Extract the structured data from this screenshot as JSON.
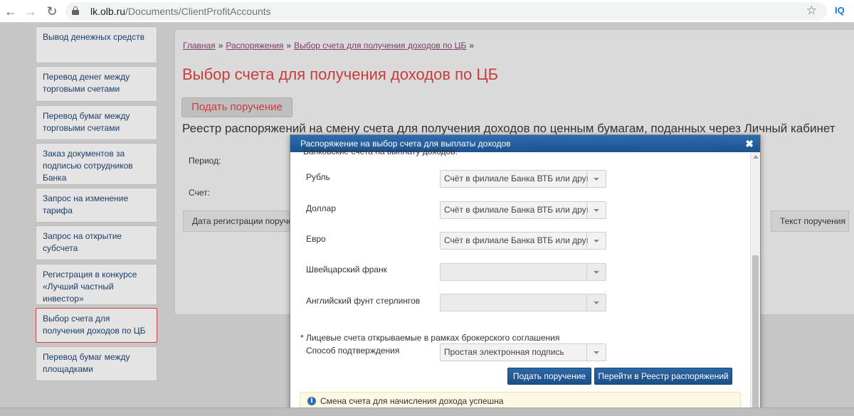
{
  "browser": {
    "url_host": "lk.olb.ru",
    "url_path": "/Documents/ClientProfitAccounts",
    "extension_label": "IQ"
  },
  "sidebar": {
    "items": [
      {
        "label": "Вывод денежных средств"
      },
      {
        "label": "Перевод денег между торговыми счетами"
      },
      {
        "label": "Перевод бумаг между торговыми счетами"
      },
      {
        "label": "Заказ документов за подписью сотрудников Банка"
      },
      {
        "label": "Запрос на изменение тарифа"
      },
      {
        "label": "Запрос на открытие субсчета"
      },
      {
        "label": "Регистрация в конкурсе «Лучший частный инвестор»"
      },
      {
        "label": "Выбор счета для получения доходов по ЦБ"
      },
      {
        "label": "Перевод бумаг между площадками"
      }
    ]
  },
  "breadcrumb": {
    "home": "Главная",
    "orders": "Распоряжения",
    "current": "Выбор счета для получения доходов по ЦБ",
    "separator": "»"
  },
  "page": {
    "title": "Выбор счета для получения доходов по ЦБ",
    "submit_label": "Подать поручение",
    "subtitle": "Реестр распоряжений на смену счета для получения доходов по ценным бумагам, поданных через Личный кабинет",
    "period_label": "Период:",
    "account_label": "Счет:",
    "table_headers": [
      "Дата регистрации поручения",
      "Текст поручения"
    ]
  },
  "modal": {
    "title": "Распоряжение на выбор счета для выплаты доходов",
    "clipped_text": "Банковские счета на выплату доходов:",
    "fields": [
      {
        "label": "Рубль",
        "value": "Счёт в филиале Банка ВТБ или другом банке"
      },
      {
        "label": "Доллар",
        "value": "Счёт в филиале Банка ВТБ или другом банке"
      },
      {
        "label": "Евро",
        "value": "Счёт в филиале Банка ВТБ или другом банке"
      },
      {
        "label": "Швейцарский франк",
        "value": ""
      },
      {
        "label": "Английский фунт стерлингов",
        "value": ""
      }
    ],
    "note": "* Лицевые счета открываемые в рамках брокерского соглашения",
    "confirm_label": "Способ подтверждения",
    "confirm_value": "Простая электронная подпись",
    "submit_label": "Подать поручение",
    "registry_label": "Перейти в Реестр распоряжений",
    "alert_text": "Смена счета для начисления дохода успешна"
  },
  "colors": {
    "accent_red": "#c93c3c",
    "header_blue": "#1c528e",
    "alert_bg": "#fcf8e3"
  }
}
